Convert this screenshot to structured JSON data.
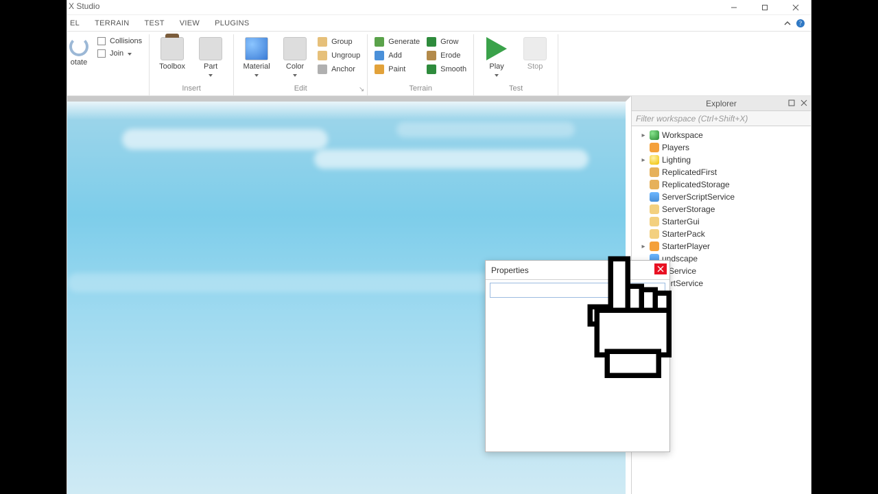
{
  "window": {
    "title_fragment": "X Studio"
  },
  "menu_tabs": {
    "t1": "EL",
    "t2": "TERRAIN",
    "t3": "TEST",
    "t4": "VIEW",
    "t5": "PLUGINS"
  },
  "ribbon": {
    "group1": {
      "rotate": "otate",
      "collisions": "Collisions",
      "join": "Join"
    },
    "insert": {
      "label": "Insert",
      "toolbox": "Toolbox",
      "part": "Part"
    },
    "edit": {
      "label": "Edit",
      "material": "Material",
      "color": "Color",
      "group": "Group",
      "ungroup": "Ungroup",
      "anchor": "Anchor"
    },
    "terrain": {
      "label": "Terrain",
      "generate": "Generate",
      "add": "Add",
      "paint": "Paint",
      "grow": "Grow",
      "erode": "Erode",
      "smooth": "Smooth"
    },
    "test": {
      "label": "Test",
      "play": "Play",
      "stop": "Stop"
    }
  },
  "explorer": {
    "title": "Explorer",
    "filter_placeholder": "Filter workspace (Ctrl+Shift+X)",
    "items": [
      {
        "label": "Workspace",
        "icon": "world",
        "expandable": true
      },
      {
        "label": "Players",
        "icon": "players",
        "expandable": false
      },
      {
        "label": "Lighting",
        "icon": "light",
        "expandable": true
      },
      {
        "label": "ReplicatedFirst",
        "icon": "box",
        "expandable": false
      },
      {
        "label": "ReplicatedStorage",
        "icon": "box",
        "expandable": false
      },
      {
        "label": "ServerScriptService",
        "icon": "script",
        "expandable": false
      },
      {
        "label": "ServerStorage",
        "icon": "folder",
        "expandable": false
      },
      {
        "label": "StarterGui",
        "icon": "folder",
        "expandable": false
      },
      {
        "label": "StarterPack",
        "icon": "folder",
        "expandable": false
      },
      {
        "label": "StarterPlayer",
        "icon": "players",
        "expandable": true
      },
      {
        "label": "undscape",
        "icon": "script",
        "expandable": false
      },
      {
        "label": "tpService",
        "icon": "script",
        "expandable": false
      },
      {
        "label": "sertService",
        "icon": "box",
        "expandable": false
      }
    ]
  },
  "properties": {
    "title": "Properties"
  }
}
